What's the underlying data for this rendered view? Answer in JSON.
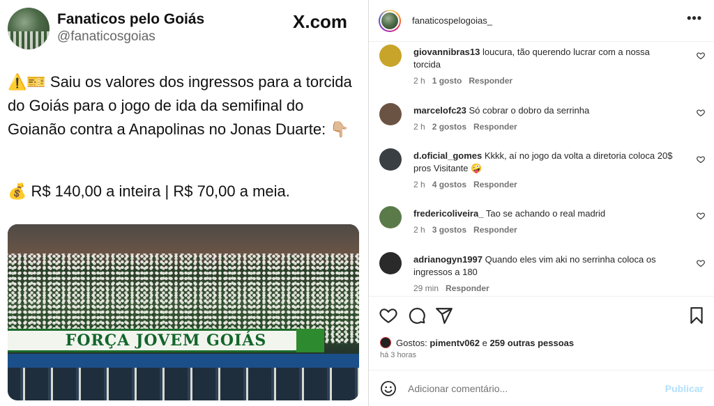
{
  "tweet": {
    "display_name": "Fanaticos pelo Goiás",
    "handle": "@fanaticosgoias",
    "source": "X.com",
    "text": "⚠️🎫 Saiu os valores dos ingressos para a torcida do Goiás para o jogo de ida da semifinal do Goianão contra a Anapolinas no Jonas Duarte: 👇🏼",
    "price_line": "💰 R$ 140,00 a inteira | R$ 70,00 a meia.",
    "photo_banner": "FORÇA JOVEM GOIÁS"
  },
  "instagram": {
    "username": "fanaticospelogoias_",
    "more": "•••",
    "comments": [
      {
        "user": "giovannibras13",
        "text": "loucura, tão querendo lucrar com a nossa torcida",
        "time": "2 h",
        "likes": "1 gosto",
        "reply": "Responder",
        "avatar_color": "#c9a42a"
      },
      {
        "user": "marcelofc23",
        "text": "Só cobrar o dobro da serrinha",
        "time": "2 h",
        "likes": "2 gostos",
        "reply": "Responder",
        "avatar_color": "#6b5344"
      },
      {
        "user": "d.oficial_gomes",
        "text": "Kkkk, aí no jogo da volta a diretoria coloca 20$ pros Visitante 🤪",
        "time": "2 h",
        "likes": "4 gostos",
        "reply": "Responder",
        "avatar_color": "#3a3f44"
      },
      {
        "user": "fredericoliveira_",
        "text": "Tao se achando o real madrid",
        "time": "2 h",
        "likes": "3 gostos",
        "reply": "Responder",
        "avatar_color": "#5a7a4a"
      },
      {
        "user": "adrianogyn1997",
        "text": "Quando eles vim aki no serrinha coloca os ingressos a 180",
        "time": "29 min",
        "likes": "",
        "reply": "Responder",
        "avatar_color": "#2a2a2a"
      }
    ],
    "likes_prefix": "Gostos:",
    "likes_user": "pimentv062",
    "likes_mid": "e",
    "likes_others": "259 outras pessoas",
    "posted_time": "há 3 horas",
    "add_comment_placeholder": "Adicionar comentário...",
    "publish_label": "Publicar"
  }
}
